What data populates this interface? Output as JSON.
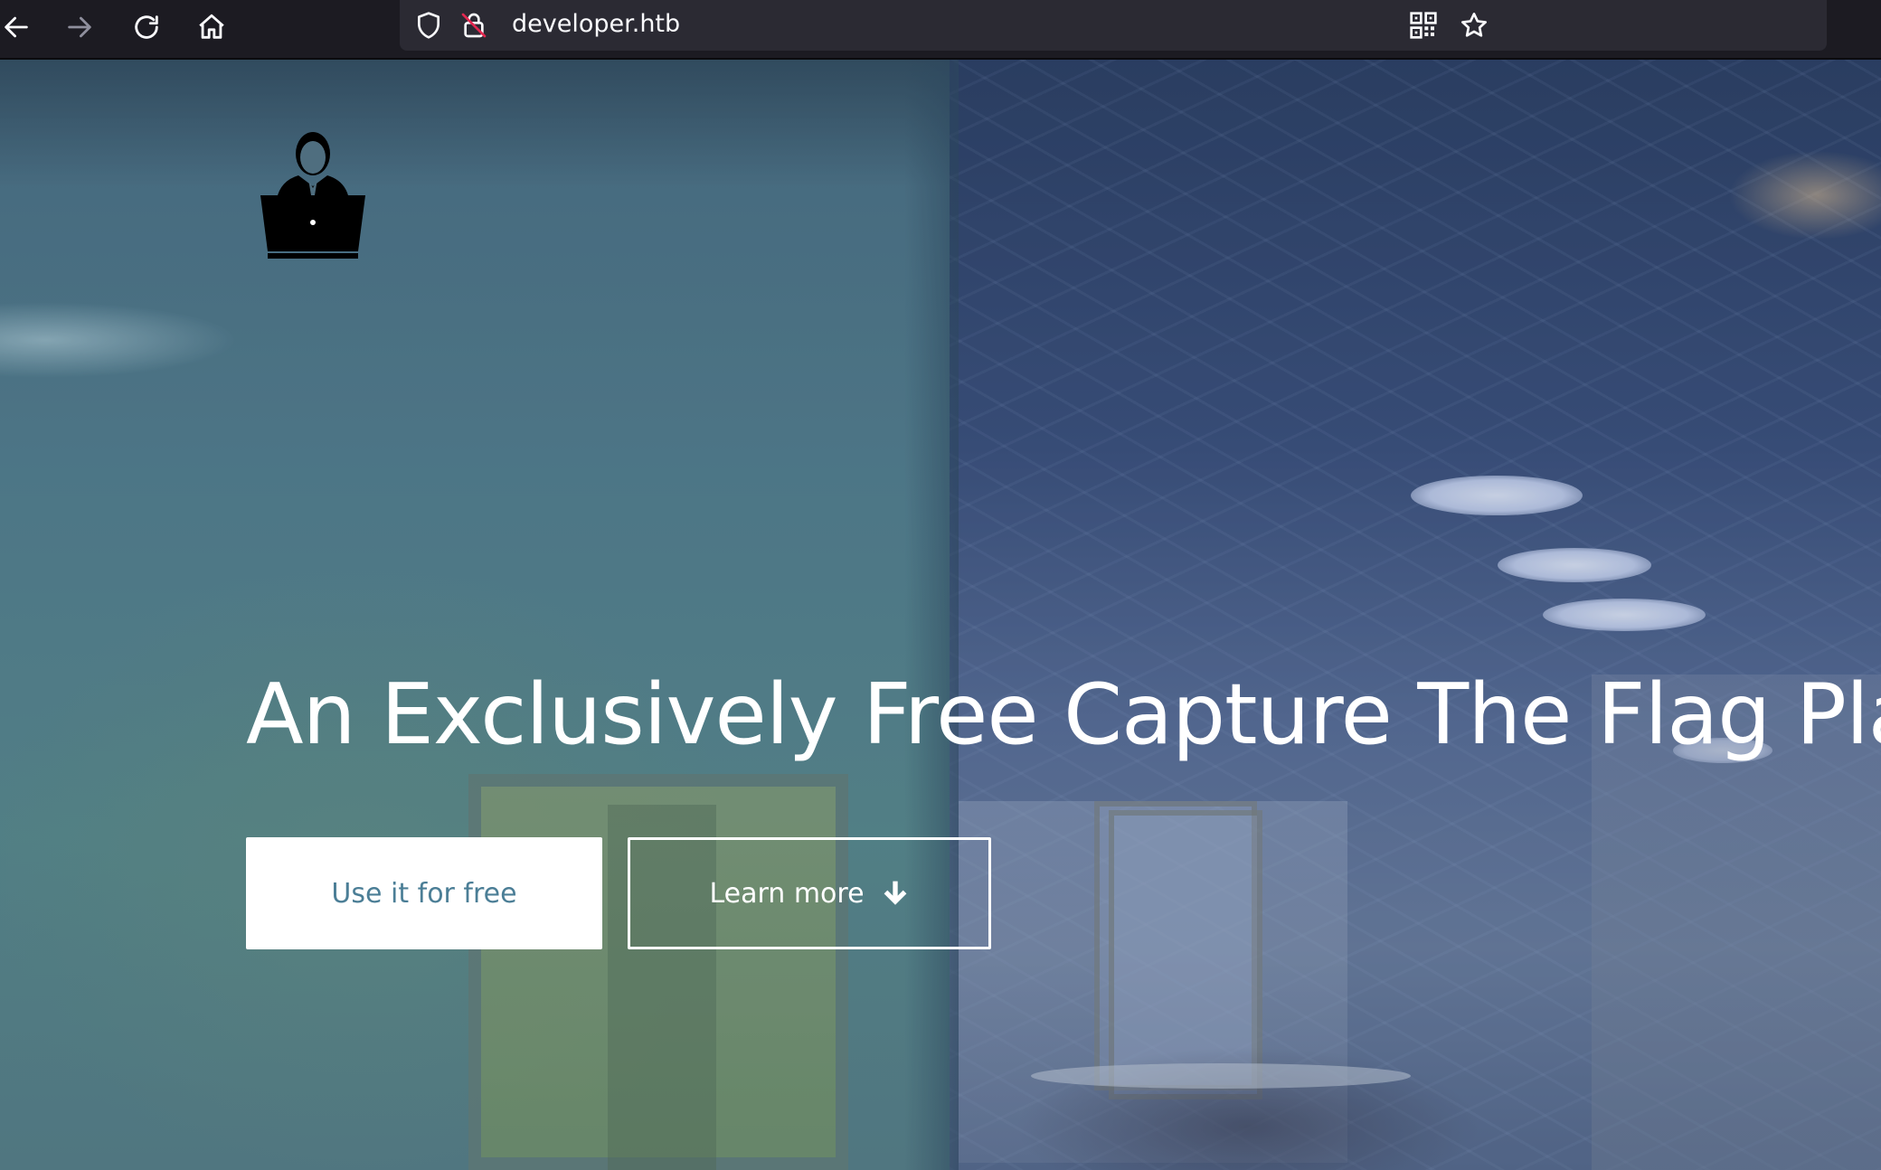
{
  "browser": {
    "url": "developer.htb",
    "icons": {
      "back": "arrow-left-icon",
      "forward": "arrow-right-icon",
      "reload": "reload-icon",
      "home": "home-icon",
      "tracking_protection": "shield-icon",
      "insecure_connection": "crossed-lock-icon",
      "qr_code": "qr-code-icon",
      "bookmark": "star-icon"
    },
    "colors": {
      "toolbar": "#1c1b22",
      "urlbar": "#2b2a33",
      "icon": "#fbfbfe",
      "forward_disabled": "#8f8f9d"
    }
  },
  "hero": {
    "logo_icon": "developer-laptop-icon",
    "title": "An Exclusively Free Capture The Flag Platform",
    "primary_button": "Use it for free",
    "secondary_button": "Learn more",
    "secondary_button_icon": "arrow-down-icon",
    "colors": {
      "title": "#ffffff",
      "primary_button_bg": "#ffffff",
      "primary_button_text": "#4b7e96",
      "secondary_button_border": "#ffffff"
    }
  }
}
